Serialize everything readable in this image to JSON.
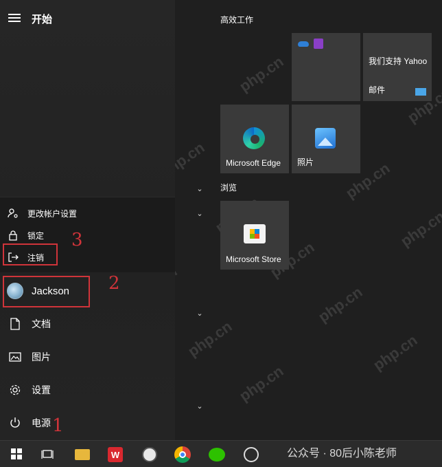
{
  "header": {
    "title": "开始"
  },
  "user_menu": {
    "items": [
      {
        "label": "更改帐户设置",
        "icon": "person-settings-icon"
      },
      {
        "label": "锁定",
        "icon": "lock-icon"
      },
      {
        "label": "注销",
        "icon": "sign-out-icon"
      }
    ]
  },
  "user": {
    "name": "Jackson"
  },
  "nav": {
    "documents": "文档",
    "pictures": "图片",
    "settings": "设置",
    "power": "电源"
  },
  "annotations": {
    "step1": "1",
    "step2": "2",
    "step3": "3"
  },
  "groups": {
    "productivity": "高效工作",
    "explore": "浏览"
  },
  "tiles": {
    "yahoo_mail_line1": "我们支持 Yahoo",
    "yahoo_mail_line2": "邮件",
    "edge": "Microsoft Edge",
    "photos": "照片",
    "store": "Microsoft Store"
  },
  "watermark_caption": "公众号 · 80后小陈老师",
  "watermark_text": "php.cn",
  "colors": {
    "annotation_red": "#d0343a",
    "tile_bg": "#3a3a3a",
    "taskbar_bg": "#2b2b2b"
  }
}
